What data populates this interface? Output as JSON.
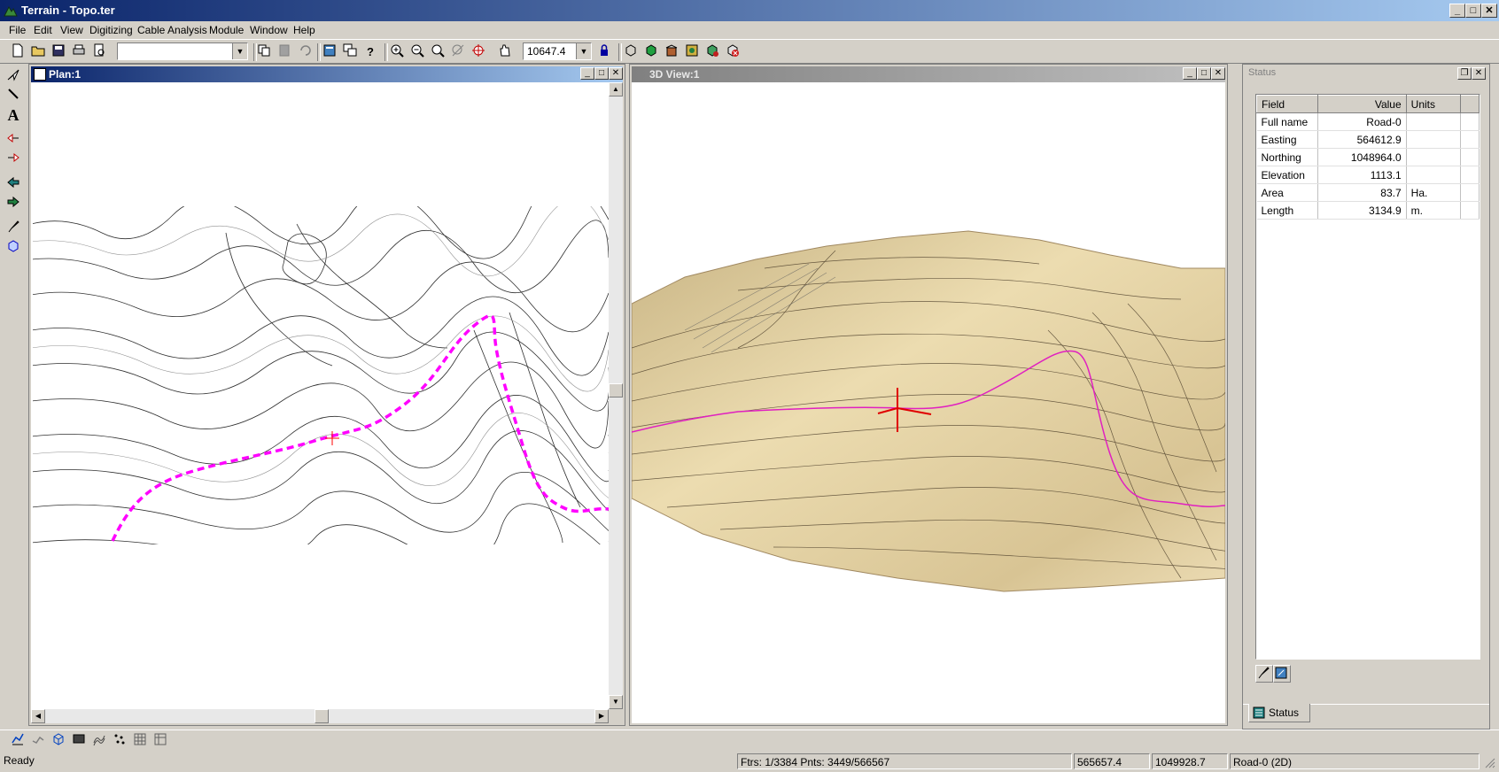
{
  "window": {
    "title": "Terrain - Topo.ter",
    "min": "_",
    "max": "□",
    "close": "✕"
  },
  "menu": [
    "File",
    "Edit",
    "View",
    "Digitizing",
    "Cable Analysis",
    "Module",
    "Window",
    "Help"
  ],
  "toolbar": {
    "layer_combo_value": "",
    "scale_value": "10647.4"
  },
  "plan_window": {
    "title": "Plan:1"
  },
  "view3d_window": {
    "title": "3D View:1"
  },
  "status_panel": {
    "title": "Status",
    "headers": {
      "field": "Field",
      "value": "Value",
      "units": "Units"
    },
    "rows": [
      {
        "field": "Full name",
        "value": "Road-0",
        "units": ""
      },
      {
        "field": "Easting",
        "value": "564612.9",
        "units": ""
      },
      {
        "field": "Northing",
        "value": "1048964.0",
        "units": ""
      },
      {
        "field": "Elevation",
        "value": "1113.1",
        "units": ""
      },
      {
        "field": "Area",
        "value": "83.7",
        "units": "Ha."
      },
      {
        "field": "Length",
        "value": "3134.9",
        "units": "m."
      }
    ],
    "tab_label": "Status"
  },
  "statusbar": {
    "message": "Ready",
    "features": "Ftrs: 1/3384  Pnts: 3449/566567",
    "easting": "565657.4",
    "northing": "1049928.7",
    "object": "Road-0 (2D)"
  },
  "colors": {
    "road": "#ff00ff",
    "cursor": "#ff0000",
    "terrain": "#e6d2a0",
    "titlebar_active": "#0a246a",
    "titlebar_inactive": "#808080"
  }
}
